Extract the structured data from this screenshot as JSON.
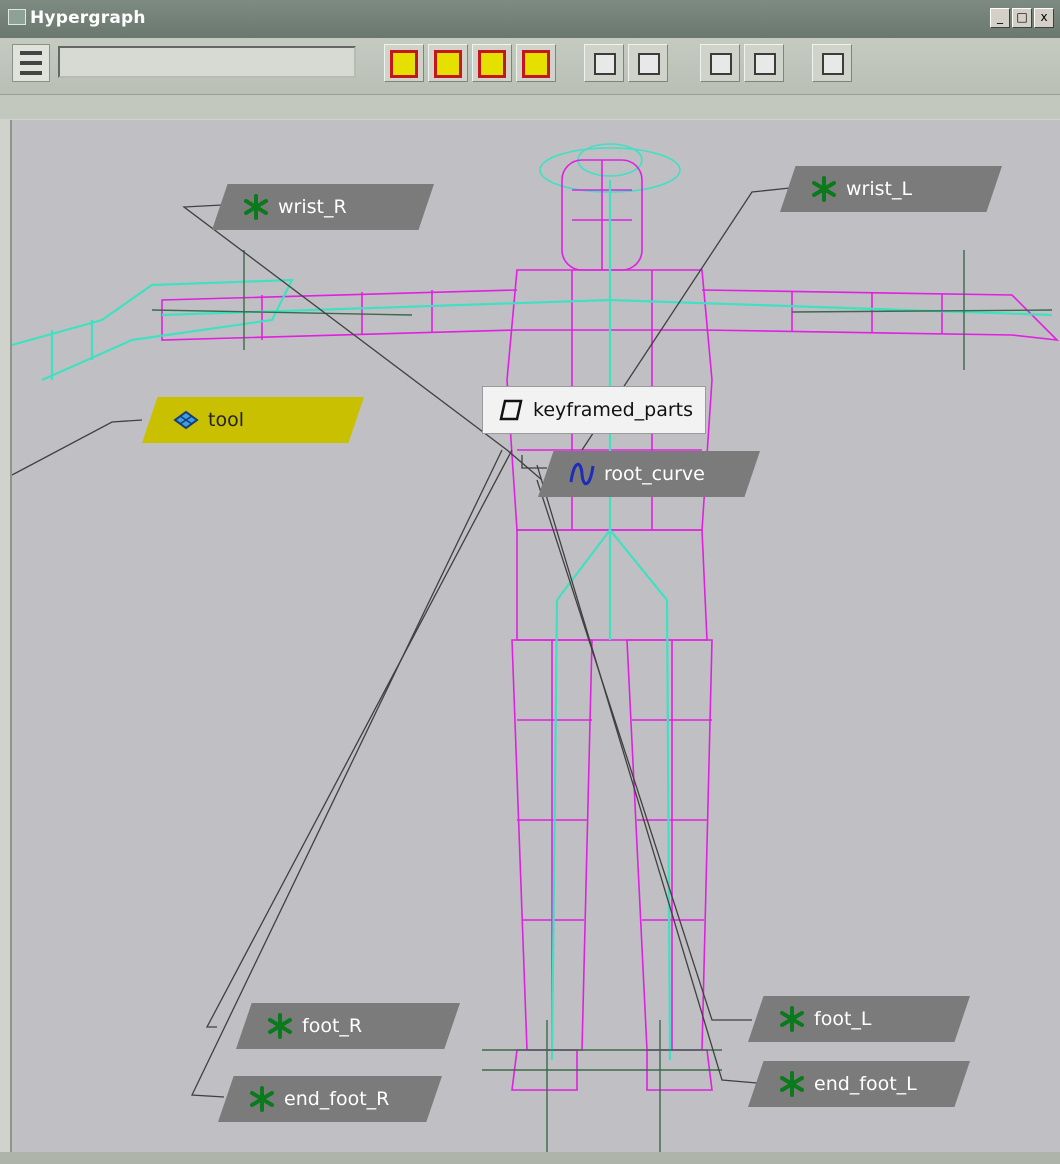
{
  "window": {
    "title": "Hypergraph",
    "controls": [
      "_",
      "□",
      "x"
    ]
  },
  "toolbar": {
    "search_value": ""
  },
  "graph": {
    "nodes": {
      "wrist_R": "wrist_R",
      "wrist_L": "wrist_L",
      "tool": "tool",
      "keyframed_parts": "keyframed_parts",
      "root_curve": "root_curve",
      "foot_R": "foot_R",
      "end_foot_R": "end_foot_R",
      "foot_L": "foot_L",
      "end_foot_L": "end_foot_L"
    }
  },
  "colors": {
    "wireframe": "#e020e0",
    "skeleton": "#40e0c0",
    "node": "#7b7b7b",
    "selected_node": "#c8c000"
  }
}
